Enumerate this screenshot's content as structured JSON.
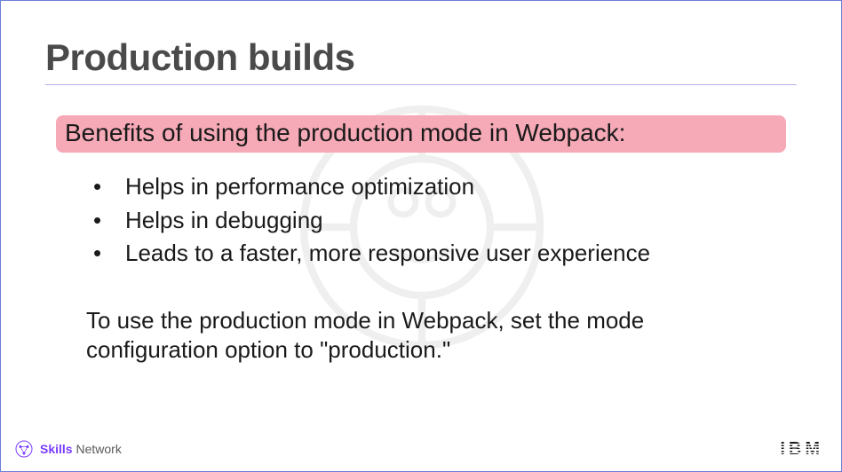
{
  "title": "Production builds",
  "highlight": "Benefits of using the production mode in Webpack:",
  "bullets": [
    "Helps in performance optimization",
    "Helps in debugging",
    "Leads to a faster, more responsive user experience"
  ],
  "paragraph": "To use the production mode in Webpack, set the mode configuration option to \"production.\"",
  "footer": {
    "skills": "Skills",
    "network": "Network",
    "ibm": "IBM"
  }
}
